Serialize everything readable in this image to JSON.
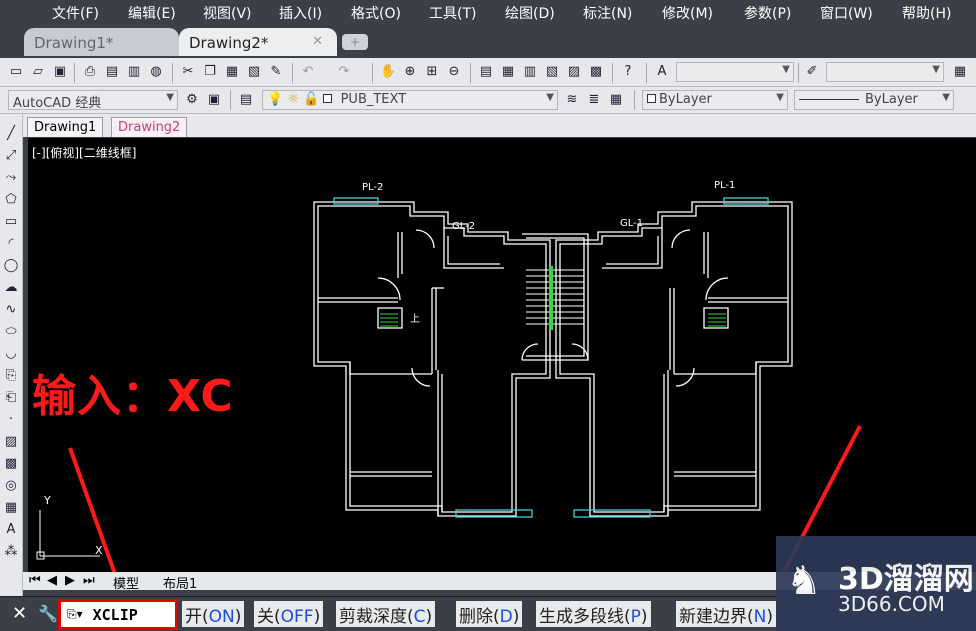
{
  "menu": [
    "文件(F)",
    "编辑(E)",
    "视图(V)",
    "插入(I)",
    "格式(O)",
    "工具(T)",
    "绘图(D)",
    "标注(N)",
    "修改(M)",
    "参数(P)",
    "窗口(W)",
    "帮助(H)"
  ],
  "doc_tabs": [
    "Drawing1*",
    "Drawing2*"
  ],
  "doc_tab_close": "✕",
  "toolbar2": {
    "workspace": "AutoCAD 经典",
    "layer": "PUB_TEXT",
    "color": "ByLayer",
    "linetype": "ByLayer"
  },
  "layout_tabs": [
    "Drawing1",
    "Drawing2"
  ],
  "viewport_label": "[-][俯视][二维线框]",
  "bottom_tabs": [
    "模型",
    "布局1"
  ],
  "drawing_labels": {
    "pl2": "PL-2",
    "pl1": "PL-1",
    "gl2": "GL-2",
    "gl1": "GL-1",
    "up": "上"
  },
  "ucs": {
    "y": "Y",
    "x": "X"
  },
  "command": {
    "text": "XCLIP",
    "options": [
      {
        "label": "开",
        "key": "ON"
      },
      {
        "label": "关",
        "key": "OFF"
      },
      {
        "label": "剪裁深度",
        "key": "C"
      },
      {
        "label": "删除",
        "key": "D"
      },
      {
        "label": "生成多段线",
        "key": "P"
      },
      {
        "label": "新建边界",
        "key": "N"
      }
    ]
  },
  "annotation": "输入：XC",
  "watermark": {
    "title": "3D溜溜网",
    "url": "3D66.COM"
  },
  "colors": {
    "annotation": "#ff1a1a",
    "accent_blue": "#1a4fd6",
    "canvas": "#000000"
  }
}
